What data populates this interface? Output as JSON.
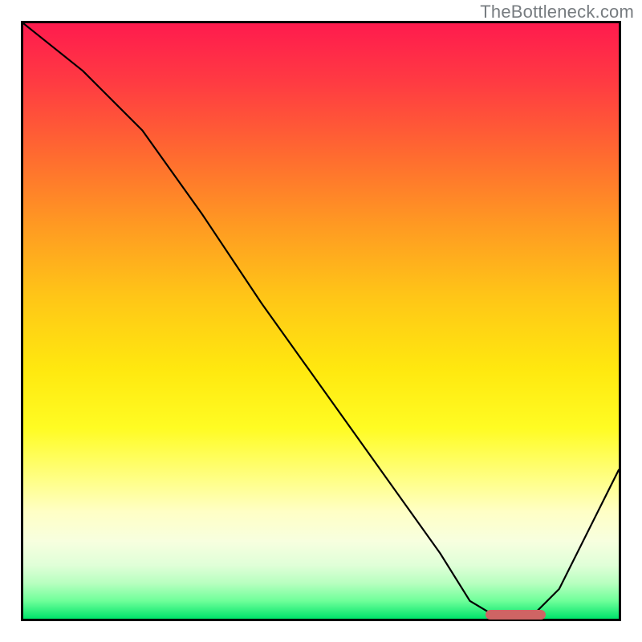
{
  "watermark": "TheBottleneck.com",
  "colors": {
    "curve": "#000000",
    "marker": "#cf6464",
    "border": "#000000"
  },
  "chart_data": {
    "type": "line",
    "title": "",
    "xlabel": "",
    "ylabel": "",
    "xlim": [
      0,
      100
    ],
    "ylim": [
      0,
      100
    ],
    "x": [
      0,
      10,
      20,
      30,
      40,
      50,
      60,
      70,
      75,
      80,
      85,
      90,
      100
    ],
    "y": [
      100,
      92,
      82,
      68,
      53,
      39,
      25,
      11,
      3,
      0,
      0,
      5,
      25
    ],
    "optimal_range_x": [
      77,
      87
    ],
    "grid": false,
    "legend": null
  }
}
